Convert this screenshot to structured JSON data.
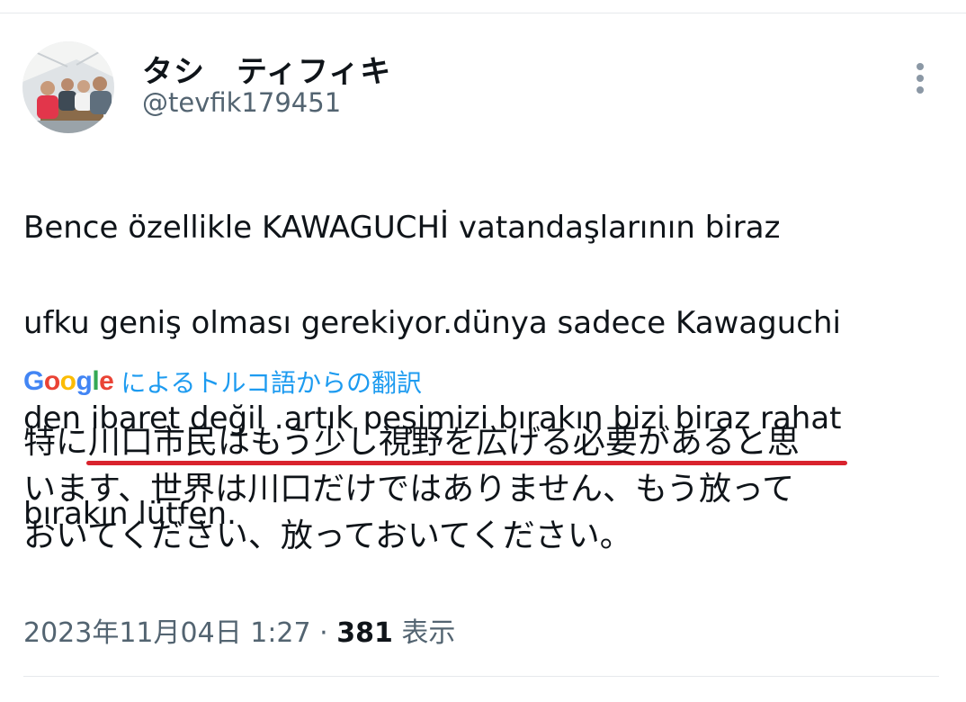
{
  "tweet": {
    "author": {
      "display_name": "タシ　ティフィキ",
      "handle": "@tevfik179451"
    },
    "text_lines": [
      "Bence özellikle KAWAGUCHİ vatandaşlarının biraz",
      "ufku geniş olması gerekiyor.dünya sadece Kawaguchi",
      "den ibaret değil .artık peşimizi bırakın bizi biraz rahat",
      "bırakın lütfen."
    ],
    "translate": {
      "provider": "Google",
      "label": "によるトルコ語からの翻訳"
    },
    "translation_lines": [
      "特に川口市民はもう少し視野を広げる必要があると思",
      "います、世界は川口だけではありません、もう放って",
      "おいてください、放っておいてください。"
    ],
    "meta": {
      "timestamp": "2023年11月04日 1:27",
      "separator": "·",
      "views_count": "381",
      "views_label": "表示"
    }
  }
}
